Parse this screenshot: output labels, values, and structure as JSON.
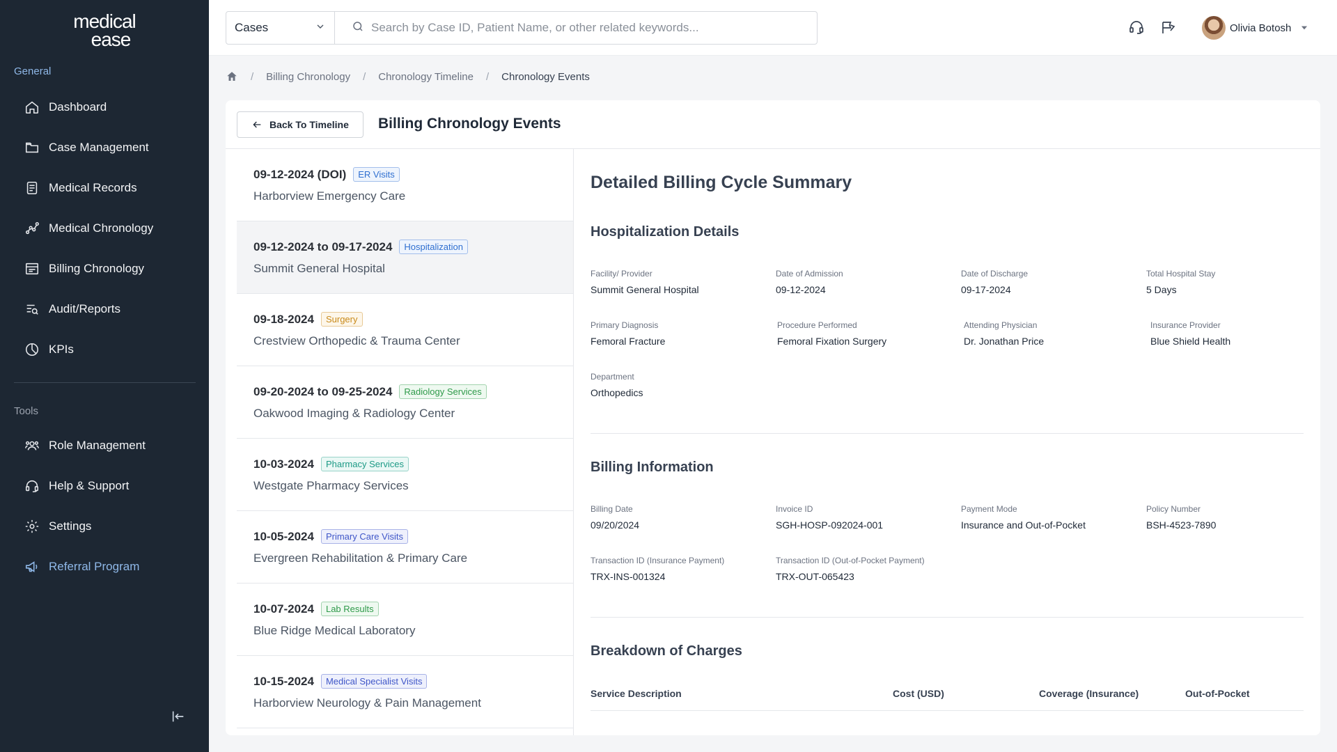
{
  "logo": {
    "line1": "medical",
    "line2": "ease"
  },
  "sidebar": {
    "general_label": "General",
    "tools_label": "Tools",
    "general_items": [
      {
        "label": "Dashboard",
        "icon": "home-icon"
      },
      {
        "label": "Case Management",
        "icon": "folder-icon"
      },
      {
        "label": "Medical Records",
        "icon": "document-icon"
      },
      {
        "label": "Medical Chronology",
        "icon": "chart-line-icon"
      },
      {
        "label": "Billing Chronology",
        "icon": "billing-icon"
      },
      {
        "label": "Audit/Reports",
        "icon": "report-search-icon"
      },
      {
        "label": "KPIs",
        "icon": "pie-chart-icon"
      }
    ],
    "tools_items": [
      {
        "label": "Role Management",
        "icon": "users-icon"
      },
      {
        "label": "Help & Support",
        "icon": "headset-icon"
      },
      {
        "label": "Settings",
        "icon": "gear-icon"
      },
      {
        "label": "Referral Program",
        "icon": "megaphone-icon"
      }
    ]
  },
  "header": {
    "case_select": "Cases",
    "search_placeholder": "Search by Case ID, Patient Name, or other related keywords...",
    "user_name": "Olivia Botosh"
  },
  "breadcrumb": [
    "Billing Chronology",
    "Chronology Timeline",
    "Chronology Events"
  ],
  "card": {
    "back_label": "Back To Timeline",
    "title": "Billing Chronology Events"
  },
  "events": [
    {
      "date": "09-12-2024 (DOI)",
      "badge": "ER Visits",
      "badge_color": "#2f6fd0",
      "badge_bg": "#eef4fd",
      "facility": "Harborview Emergency Care"
    },
    {
      "date": "09-12-2024 to 09-17-2024",
      "badge": "Hospitalization",
      "badge_color": "#2f6fd0",
      "badge_bg": "#eef4fd",
      "facility": "Summit General Hospital"
    },
    {
      "date": "09-18-2024",
      "badge": "Surgery",
      "badge_color": "#c98a1a",
      "badge_bg": "#fdf6e9",
      "facility": "Crestview Orthopedic & Trauma Center"
    },
    {
      "date": "09-20-2024 to 09-25-2024",
      "badge": "Radiology Services",
      "badge_color": "#2f9a4a",
      "badge_bg": "#eef9f0",
      "facility": "Oakwood Imaging & Radiology Center"
    },
    {
      "date": "10-03-2024",
      "badge": "Pharmacy Services",
      "badge_color": "#1d9a86",
      "badge_bg": "#eaf8f5",
      "facility": "Westgate Pharmacy Services"
    },
    {
      "date": "10-05-2024",
      "badge": "Primary Care Visits",
      "badge_color": "#3f56c8",
      "badge_bg": "#eef0fc",
      "facility": "Evergreen Rehabilitation & Primary Care"
    },
    {
      "date": "10-07-2024",
      "badge": "Lab Results",
      "badge_color": "#2f9a4a",
      "badge_bg": "#eef9f0",
      "facility": "Blue Ridge Medical Laboratory"
    },
    {
      "date": "10-15-2024",
      "badge": "Medical Specialist Visits",
      "badge_color": "#3f56c8",
      "badge_bg": "#eef0fc",
      "facility": "Harborview Neurology & Pain Management"
    }
  ],
  "detail": {
    "title": "Detailed Billing Cycle Summary",
    "hosp_title": "Hospitalization Details",
    "hosp_fields": [
      {
        "label": "Facility/ Provider",
        "value": "Summit General Hospital"
      },
      {
        "label": "Date of Admission",
        "value": "09-12-2024"
      },
      {
        "label": "Date of Discharge",
        "value": "09-17-2024"
      },
      {
        "label": "Total Hospital Stay",
        "value": "5 Days"
      },
      {
        "label": "Primary Diagnosis",
        "value": "Femoral Fracture"
      },
      {
        "label": "Procedure Performed",
        "value": "Femoral Fixation Surgery"
      },
      {
        "label": "Attending Physician",
        "value": "Dr. Jonathan Price"
      },
      {
        "label": "Insurance Provider",
        "value": "Blue Shield Health"
      },
      {
        "label": "Department",
        "value": "Orthopedics"
      }
    ],
    "billing_title": "Billing Information",
    "billing_fields": [
      {
        "label": "Billing Date",
        "value": "09/20/2024"
      },
      {
        "label": "Invoice ID",
        "value": "SGH-HOSP-092024-001"
      },
      {
        "label": "Payment Mode",
        "value": "Insurance and Out-of-Pocket"
      },
      {
        "label": "Policy Number",
        "value": "BSH-4523-7890"
      },
      {
        "label": "Transaction ID (Insurance Payment)",
        "value": "TRX-INS-001324"
      },
      {
        "label": "Transaction ID (Out-of-Pocket Payment)",
        "value": "TRX-OUT-065423"
      }
    ],
    "charges_title": "Breakdown of Charges",
    "charges_columns": [
      "Service Description",
      "Cost (USD)",
      "Coverage (Insurance)",
      "Out-of-Pocket"
    ]
  },
  "colors": {
    "sidebar_bg": "#1d2733",
    "accent": "#8fb8e8",
    "active_row": "#f3f4f6"
  }
}
